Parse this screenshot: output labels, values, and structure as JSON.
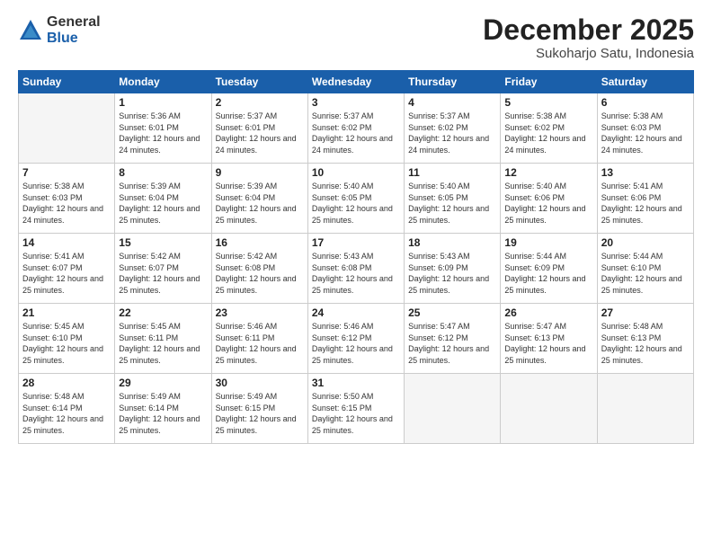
{
  "logo": {
    "general": "General",
    "blue": "Blue"
  },
  "header": {
    "month": "December 2025",
    "location": "Sukoharjo Satu, Indonesia"
  },
  "days_of_week": [
    "Sunday",
    "Monday",
    "Tuesday",
    "Wednesday",
    "Thursday",
    "Friday",
    "Saturday"
  ],
  "weeks": [
    [
      {
        "day": "",
        "info": ""
      },
      {
        "day": "1",
        "info": "Sunrise: 5:36 AM\nSunset: 6:01 PM\nDaylight: 12 hours\nand 24 minutes."
      },
      {
        "day": "2",
        "info": "Sunrise: 5:37 AM\nSunset: 6:01 PM\nDaylight: 12 hours\nand 24 minutes."
      },
      {
        "day": "3",
        "info": "Sunrise: 5:37 AM\nSunset: 6:02 PM\nDaylight: 12 hours\nand 24 minutes."
      },
      {
        "day": "4",
        "info": "Sunrise: 5:37 AM\nSunset: 6:02 PM\nDaylight: 12 hours\nand 24 minutes."
      },
      {
        "day": "5",
        "info": "Sunrise: 5:38 AM\nSunset: 6:02 PM\nDaylight: 12 hours\nand 24 minutes."
      },
      {
        "day": "6",
        "info": "Sunrise: 5:38 AM\nSunset: 6:03 PM\nDaylight: 12 hours\nand 24 minutes."
      }
    ],
    [
      {
        "day": "7",
        "info": "Sunrise: 5:38 AM\nSunset: 6:03 PM\nDaylight: 12 hours\nand 24 minutes."
      },
      {
        "day": "8",
        "info": "Sunrise: 5:39 AM\nSunset: 6:04 PM\nDaylight: 12 hours\nand 25 minutes."
      },
      {
        "day": "9",
        "info": "Sunrise: 5:39 AM\nSunset: 6:04 PM\nDaylight: 12 hours\nand 25 minutes."
      },
      {
        "day": "10",
        "info": "Sunrise: 5:40 AM\nSunset: 6:05 PM\nDaylight: 12 hours\nand 25 minutes."
      },
      {
        "day": "11",
        "info": "Sunrise: 5:40 AM\nSunset: 6:05 PM\nDaylight: 12 hours\nand 25 minutes."
      },
      {
        "day": "12",
        "info": "Sunrise: 5:40 AM\nSunset: 6:06 PM\nDaylight: 12 hours\nand 25 minutes."
      },
      {
        "day": "13",
        "info": "Sunrise: 5:41 AM\nSunset: 6:06 PM\nDaylight: 12 hours\nand 25 minutes."
      }
    ],
    [
      {
        "day": "14",
        "info": "Sunrise: 5:41 AM\nSunset: 6:07 PM\nDaylight: 12 hours\nand 25 minutes."
      },
      {
        "day": "15",
        "info": "Sunrise: 5:42 AM\nSunset: 6:07 PM\nDaylight: 12 hours\nand 25 minutes."
      },
      {
        "day": "16",
        "info": "Sunrise: 5:42 AM\nSunset: 6:08 PM\nDaylight: 12 hours\nand 25 minutes."
      },
      {
        "day": "17",
        "info": "Sunrise: 5:43 AM\nSunset: 6:08 PM\nDaylight: 12 hours\nand 25 minutes."
      },
      {
        "day": "18",
        "info": "Sunrise: 5:43 AM\nSunset: 6:09 PM\nDaylight: 12 hours\nand 25 minutes."
      },
      {
        "day": "19",
        "info": "Sunrise: 5:44 AM\nSunset: 6:09 PM\nDaylight: 12 hours\nand 25 minutes."
      },
      {
        "day": "20",
        "info": "Sunrise: 5:44 AM\nSunset: 6:10 PM\nDaylight: 12 hours\nand 25 minutes."
      }
    ],
    [
      {
        "day": "21",
        "info": "Sunrise: 5:45 AM\nSunset: 6:10 PM\nDaylight: 12 hours\nand 25 minutes."
      },
      {
        "day": "22",
        "info": "Sunrise: 5:45 AM\nSunset: 6:11 PM\nDaylight: 12 hours\nand 25 minutes."
      },
      {
        "day": "23",
        "info": "Sunrise: 5:46 AM\nSunset: 6:11 PM\nDaylight: 12 hours\nand 25 minutes."
      },
      {
        "day": "24",
        "info": "Sunrise: 5:46 AM\nSunset: 6:12 PM\nDaylight: 12 hours\nand 25 minutes."
      },
      {
        "day": "25",
        "info": "Sunrise: 5:47 AM\nSunset: 6:12 PM\nDaylight: 12 hours\nand 25 minutes."
      },
      {
        "day": "26",
        "info": "Sunrise: 5:47 AM\nSunset: 6:13 PM\nDaylight: 12 hours\nand 25 minutes."
      },
      {
        "day": "27",
        "info": "Sunrise: 5:48 AM\nSunset: 6:13 PM\nDaylight: 12 hours\nand 25 minutes."
      }
    ],
    [
      {
        "day": "28",
        "info": "Sunrise: 5:48 AM\nSunset: 6:14 PM\nDaylight: 12 hours\nand 25 minutes."
      },
      {
        "day": "29",
        "info": "Sunrise: 5:49 AM\nSunset: 6:14 PM\nDaylight: 12 hours\nand 25 minutes."
      },
      {
        "day": "30",
        "info": "Sunrise: 5:49 AM\nSunset: 6:15 PM\nDaylight: 12 hours\nand 25 minutes."
      },
      {
        "day": "31",
        "info": "Sunrise: 5:50 AM\nSunset: 6:15 PM\nDaylight: 12 hours\nand 25 minutes."
      },
      {
        "day": "",
        "info": ""
      },
      {
        "day": "",
        "info": ""
      },
      {
        "day": "",
        "info": ""
      }
    ]
  ]
}
